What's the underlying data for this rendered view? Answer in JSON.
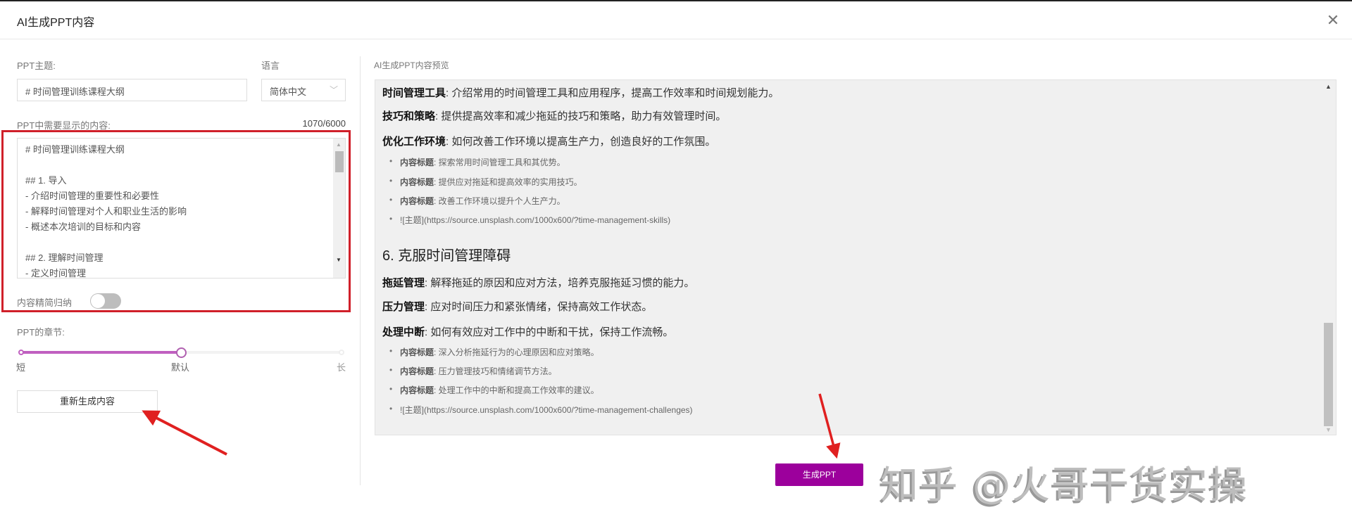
{
  "dialog": {
    "title": "AI生成PPT内容",
    "close_icon": "close-icon"
  },
  "left": {
    "topic_label": "PPT主题:",
    "topic_value": "# 时间管理训练课程大纲",
    "language_label": "语言",
    "language_value": "简体中文",
    "content_label": "PPT中需要显示的内容:",
    "counter": "1070/6000",
    "content_lines": [
      "# 时间管理训练课程大纲",
      "",
      "## 1. 导入",
      "- 介绍时间管理的重要性和必要性",
      "- 解释时间管理对个人和职业生活的影响",
      "- 概述本次培训的目标和内容",
      "",
      "## 2. 理解时间管理",
      "- 定义时间管理"
    ],
    "simplify_label": "内容精简归纳",
    "simplify_on": false,
    "sections_label": "PPT的章节:",
    "slider": {
      "labels": [
        "短",
        "默认",
        "长"
      ],
      "value_index": 1,
      "fraction": 0.5
    },
    "regenerate_label": "重新生成内容"
  },
  "right": {
    "preview_label": "AI生成PPT内容预览",
    "items": [
      {
        "type": "p",
        "key": "时间管理工具",
        "text": ": 介绍常用的时间管理工具和应用程序，提高工作效率和时间规划能力。"
      },
      {
        "type": "p",
        "key": "技巧和策略",
        "text": ": 提供提高效率和减少拖延的技巧和策略，助力有效管理时间。"
      },
      {
        "type": "p",
        "key": "优化工作环境",
        "text": ": 如何改善工作环境以提高生产力，创造良好的工作氛围。"
      },
      {
        "type": "li",
        "key": "内容标题",
        "text": ": 探索常用时间管理工具和其优势。"
      },
      {
        "type": "li",
        "key": "内容标题",
        "text": ": 提供应对拖延和提高效率的实用技巧。"
      },
      {
        "type": "li",
        "key": "内容标题",
        "text": ": 改善工作环境以提升个人生产力。"
      },
      {
        "type": "li",
        "key": "",
        "text": "![主题](https://source.unsplash.com/1000x600/?time-management-skills)"
      },
      {
        "type": "h",
        "key": "",
        "text": "6. 克服时间管理障碍"
      },
      {
        "type": "p",
        "key": "拖延管理",
        "text": ": 解释拖延的原因和应对方法，培养克服拖延习惯的能力。"
      },
      {
        "type": "p",
        "key": "压力管理",
        "text": ": 应对时间压力和紧张情绪，保持高效工作状态。"
      },
      {
        "type": "p",
        "key": "处理中断",
        "text": ": 如何有效应对工作中的中断和干扰，保持工作流畅。"
      },
      {
        "type": "li",
        "key": "内容标题",
        "text": ": 深入分析拖延行为的心理原因和应对策略。"
      },
      {
        "type": "li",
        "key": "内容标题",
        "text": ": 压力管理技巧和情绪调节方法。"
      },
      {
        "type": "li",
        "key": "内容标题",
        "text": ": 处理工作中的中断和提高工作效率的建议。"
      },
      {
        "type": "li",
        "key": "",
        "text": "![主题](https://source.unsplash.com/1000x600/?time-management-challenges)"
      }
    ],
    "generate_label": "生成PPT"
  },
  "watermark": "知乎 @火哥干货实操",
  "colors": {
    "accent": "#9c009c",
    "slider": "#c060c0",
    "annotation": "#d0202a"
  }
}
